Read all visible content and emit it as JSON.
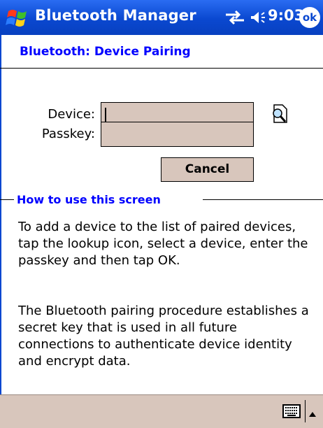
{
  "titlebar": {
    "app_title": "Bluetooth Manager",
    "time": "9:03",
    "ok_label": "ok"
  },
  "page": {
    "title": "Bluetooth: Device Pairing"
  },
  "form": {
    "device_label": "Device:",
    "device_value": "",
    "passkey_label": "Passkey:",
    "passkey_value": "",
    "cancel_label": "Cancel"
  },
  "help": {
    "section_title": "How to use this screen",
    "paragraph_1": "To add a device to the list of paired devices, tap the lookup icon, select a device, enter the passkey and then tap OK.",
    "paragraph_2": "The Bluetooth pairing procedure establishes a secret key that is used in all future connections to authenticate device identity and encrypt data."
  },
  "icons": {
    "start": "windows-flag-icon",
    "connectivity": "connectivity-icon",
    "volume": "speaker-icon",
    "lookup": "lookup-icon",
    "keyboard": "keyboard-icon",
    "input_menu": "up-arrow-icon"
  },
  "colors": {
    "titlebar": "#0a48d0",
    "accent_text": "#0000ff",
    "field_bg": "#d8c6bc",
    "bottombar_bg": "#d8c6bc"
  }
}
